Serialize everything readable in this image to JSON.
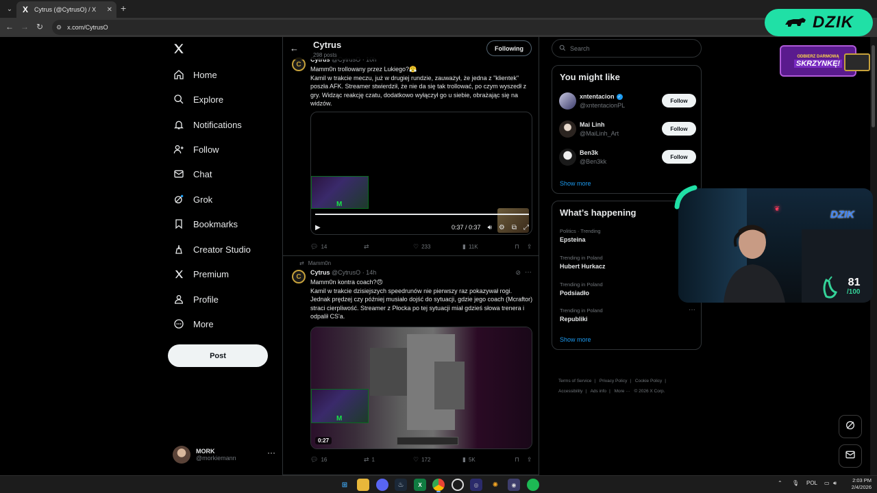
{
  "browser": {
    "tab_title": "Cytrus (@CytrusO) / X",
    "tab_favicon": "X",
    "tab_close": "✕",
    "tab_new": "+",
    "url": "x.com/CytrusO"
  },
  "nav": {
    "items": [
      {
        "label": "Home",
        "icon": "home-icon"
      },
      {
        "label": "Explore",
        "icon": "search-icon"
      },
      {
        "label": "Notifications",
        "icon": "bell-icon"
      },
      {
        "label": "Follow",
        "icon": "add-user-icon"
      },
      {
        "label": "Chat",
        "icon": "mail-icon"
      },
      {
        "label": "Grok",
        "icon": "grok-icon"
      },
      {
        "label": "Bookmarks",
        "icon": "bookmark-icon"
      },
      {
        "label": "Creator Studio",
        "icon": "creator-studio-icon"
      },
      {
        "label": "Premium",
        "icon": "x-logo-icon"
      },
      {
        "label": "Profile",
        "icon": "person-icon"
      },
      {
        "label": "More",
        "icon": "more-circle-icon"
      }
    ],
    "post_label": "Post",
    "account_name": "MORK",
    "account_handle": "@morkiemann",
    "account_more": "···"
  },
  "header": {
    "name": "Cytrus",
    "posts": "298 posts",
    "following_label": "Following"
  },
  "tweets": [
    {
      "name": "Cytrus",
      "handle": "@CytrusO",
      "time": "· 10h",
      "text": "Mamm0n trollowany przez Lukiego?😤\nKamil w trakcie meczu, już w drugiej rundzie, zauważył, że jedna z \"klientek\" poszła AFK. Streamer stwierdził, że nie da się tak trollować, po czym wyszedł z gry. Widząc reakcję czatu, dodatkowo wyłączył go u siebie, obrażając się na widzów.",
      "video_time": "0:37 / 0:37",
      "replies": "14",
      "reposts": "",
      "likes": "233",
      "views": "11K"
    },
    {
      "repost_label": "Mamm0n",
      "name": "Cytrus",
      "handle": "@CytrusO",
      "time": "· 14h",
      "text": "Mamm0n kontra coach?😠\nKamil w trakcie dzisiejszych speedrunów nie pierwszy raz pokazywał rogi. Jednak prędzej czy później musiało dojść do sytuacji, gdzie jego coach (Mcraftor) straci cierpliwość. Streamer z Płocka po tej sytuacji miał gdzieś słowa trenera i odpalił CS'a.",
      "video_duration": "0:27",
      "replies": "16",
      "reposts": "1",
      "likes": "172",
      "views": "5K"
    }
  ],
  "right": {
    "search_placeholder": "Search",
    "you_might_like_title": "You might like",
    "suggestions": [
      {
        "name": "xntentacion",
        "handle": "@xntentacionPL",
        "verified": true,
        "follow_label": "Follow"
      },
      {
        "name": "Mai Linh",
        "handle": "@MaiLinh_Art",
        "verified": false,
        "follow_label": "Follow"
      },
      {
        "name": "Ben3k",
        "handle": "@Ben3kk",
        "verified": false,
        "follow_label": "Follow"
      }
    ],
    "show_more": "Show more",
    "happening_title": "What’s happening",
    "trends": [
      {
        "category": "Politics · Trending",
        "name": "Epsteina"
      },
      {
        "category": "Trending in Poland",
        "name": "Hubert Hurkacz"
      },
      {
        "category": "Trending in Poland",
        "name": "Podsiadło"
      },
      {
        "category": "Trending in Poland",
        "name": "Republiki"
      }
    ],
    "trend_more": "···",
    "footer": [
      "Terms of Service",
      "|",
      "Privacy Policy",
      "|",
      "Cookie Policy",
      "|",
      "Accessibility",
      "|",
      "Ads info",
      "|",
      "More ···",
      "© 2026 X Corp."
    ]
  },
  "overlay": {
    "dzik_label": "DZIK",
    "promo_small": "ODBIERZ DARMOWĄ",
    "promo_big": "SKRZYNKĘ!",
    "webcam_logo": "DZIK",
    "score": "81",
    "score_max": "/100"
  },
  "taskbar": {
    "language": "POL",
    "time": "2:03 PM",
    "date": "2/4/2026"
  },
  "colors": {
    "accent": "#1d9bf0",
    "dzik": "#20e0a6"
  }
}
